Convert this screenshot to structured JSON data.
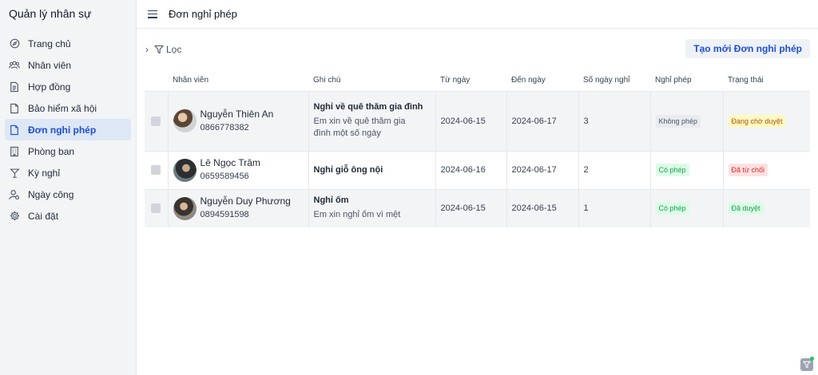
{
  "app": {
    "title": "Quản lý nhân sự"
  },
  "sidebar": {
    "items": [
      {
        "label": "Trang chủ",
        "icon": "compass-icon",
        "active": false
      },
      {
        "label": "Nhân viên",
        "icon": "users-icon",
        "active": false
      },
      {
        "label": "Hợp đồng",
        "icon": "document-icon",
        "active": false
      },
      {
        "label": "Bảo hiểm xã hội",
        "icon": "file-icon",
        "active": false
      },
      {
        "label": "Đơn nghỉ phép",
        "icon": "file-icon",
        "active": true
      },
      {
        "label": "Phòng ban",
        "icon": "building-icon",
        "active": false
      },
      {
        "label": "Kỳ nghỉ",
        "icon": "cocktail-icon",
        "active": false
      },
      {
        "label": "Ngày công",
        "icon": "user-settings-icon",
        "active": false
      },
      {
        "label": "Cài đặt",
        "icon": "gear-icon",
        "active": false
      }
    ]
  },
  "header": {
    "title": "Đơn nghỉ phép"
  },
  "toolbar": {
    "filter_label": "Lọc",
    "create_label": "Tạo mới Đơn nghỉ phép"
  },
  "table": {
    "columns": [
      "Nhân viên",
      "Ghi chú",
      "Từ ngày",
      "Đến ngày",
      "Số ngày nghỉ",
      "Nghỉ phép",
      "Trạng thái"
    ],
    "rows": [
      {
        "name": "Nguyễn Thiên An",
        "phone": "0866778382",
        "note_title": "Nghỉ về quê thăm gia đình",
        "note_desc": "Em xin về quê thăm gia đình một số ngày",
        "from": "2024-06-15",
        "to": "2024-06-17",
        "days": "3",
        "leave": "Không phép",
        "status": "Đang chờ duyệt"
      },
      {
        "name": "Lê Ngọc Trâm",
        "phone": "0659589456",
        "note_title": "Nghỉ giỗ ông nội",
        "note_desc": "",
        "from": "2024-06-16",
        "to": "2024-06-17",
        "days": "2",
        "leave": "Có phép",
        "status": "Đã từ chối"
      },
      {
        "name": "Nguyễn Duy Phương",
        "phone": "0894591598",
        "note_title": "Nghỉ ốm",
        "note_desc": "Em xin nghỉ ốm vì mệt",
        "from": "2024-06-15",
        "to": "2024-06-15",
        "days": "1",
        "leave": "Có phép",
        "status": "Đã duyệt"
      }
    ]
  },
  "colors": {
    "accent": "#1d4ed8",
    "active_bg": "#dde7f5",
    "status_pending": "#b45309",
    "status_rejected": "#dc2626",
    "status_approved": "#16a34a"
  }
}
